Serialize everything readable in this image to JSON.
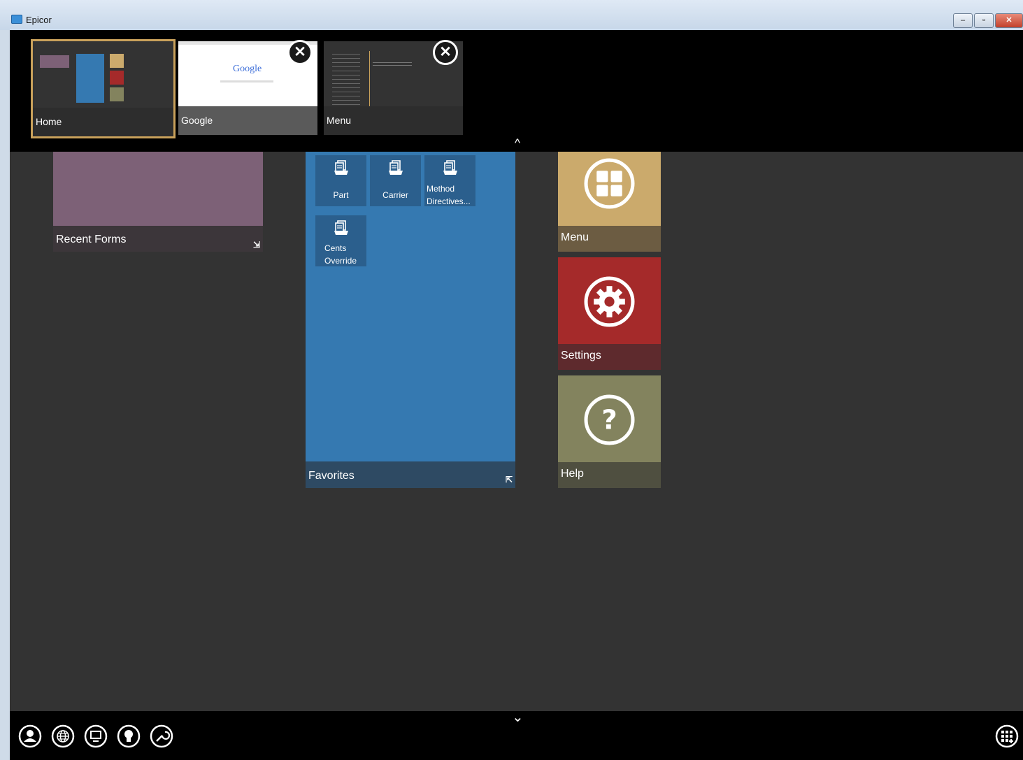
{
  "window": {
    "title": "Epicor",
    "controls": {
      "minimize": "–",
      "restore": "▫",
      "close": "✕"
    }
  },
  "switcher": {
    "thumbnails": [
      {
        "label": "Home",
        "active": true
      },
      {
        "label": "Google",
        "closable": true,
        "preview_text": "Google"
      },
      {
        "label": "Menu",
        "closable": true
      }
    ],
    "collapse_caret": "^"
  },
  "tiles": {
    "recent_forms": {
      "label": "Recent Forms",
      "resize_glyph": "⇲",
      "color": "#7d6177"
    },
    "favorites": {
      "label": "Favorites",
      "resize_glyph": "⇱",
      "color": "#3579b1",
      "items": [
        {
          "line1": "Part",
          "line2": ""
        },
        {
          "line1": "Carrier",
          "line2": ""
        },
        {
          "line1": "Method",
          "line2": "Directives..."
        },
        {
          "line1": "Cents",
          "line2": "Override"
        }
      ]
    },
    "menu": {
      "label": "Menu",
      "icon": "grid-icon",
      "color": "#cbaa6c"
    },
    "settings": {
      "label": "Settings",
      "icon": "gear-icon",
      "color": "#a52a2a"
    },
    "help": {
      "label": "Help",
      "icon": "question-icon",
      "color": "#83835e"
    }
  },
  "taskbar": {
    "expand_caret": "⌄",
    "icons": [
      "user-icon",
      "globe-icon",
      "monitor-icon",
      "lightbulb-icon",
      "wrench-icon"
    ],
    "right_icon": "add-tile-icon"
  }
}
